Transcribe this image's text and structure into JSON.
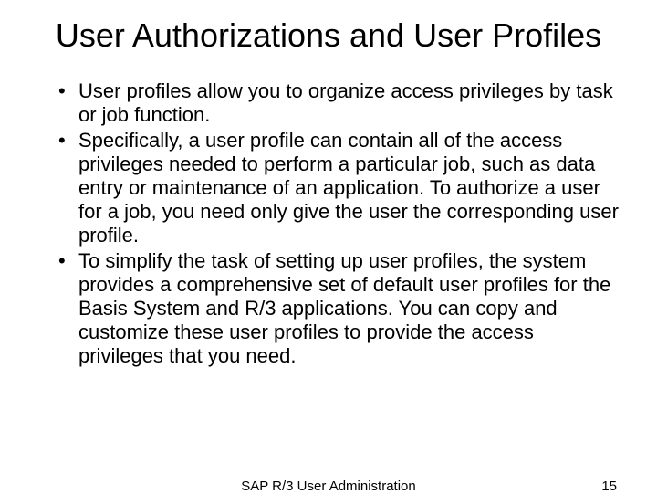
{
  "title": "User Authorizations and User Profiles",
  "bullets": [
    "User profiles allow you to organize access privileges by task or job function.",
    "Specifically, a user profile can contain all of the access privileges needed to perform a particular job, such as data entry or maintenance of an application. To authorize a user for a job, you need only give the user the corresponding user profile.",
    "To simplify the task of setting up user profiles, the system provides a comprehensive set of default user profiles for the Basis System and R/3 applications. You can copy and customize these user profiles to provide the access privileges that you need."
  ],
  "footer": {
    "center": "SAP R/3 User Administration",
    "page": "15"
  }
}
